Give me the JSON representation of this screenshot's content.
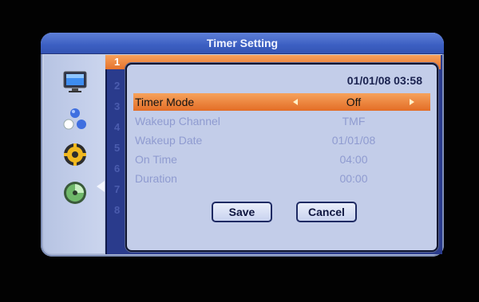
{
  "window": {
    "title": "Timer Setting"
  },
  "list": {
    "numbers": [
      "1",
      "2",
      "3",
      "4",
      "5",
      "6",
      "7",
      "8"
    ]
  },
  "dialog": {
    "datetime": "01/01/08 03:58",
    "rows": [
      {
        "label": "Timer Mode",
        "value": "Off"
      },
      {
        "label": "Wakeup Channel",
        "value": "TMF"
      },
      {
        "label": "Wakeup Date",
        "value": "01/01/08"
      },
      {
        "label": "On Time",
        "value": "04:00"
      },
      {
        "label": "Duration",
        "value": "00:00"
      }
    ],
    "buttons": {
      "save": "Save",
      "cancel": "Cancel"
    }
  },
  "sidebar": {
    "icons": [
      "tv-monitor-icon",
      "balls-icon",
      "gear-icon",
      "disc-icon"
    ],
    "selected": "gear-icon"
  },
  "colors": {
    "accent": "#e6732d",
    "title_bar": "#3c5fc2",
    "panel": "#c3cde9"
  }
}
